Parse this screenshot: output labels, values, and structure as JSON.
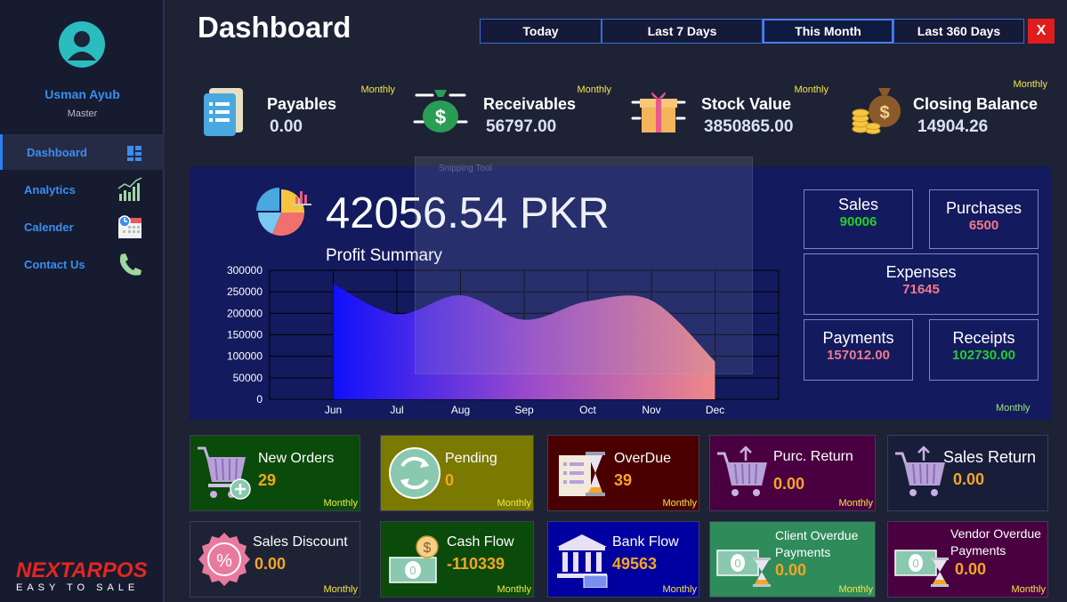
{
  "app": {
    "title": "Dashboard"
  },
  "user": {
    "name": "Usman Ayub",
    "role": "Master"
  },
  "sidebar": {
    "items": [
      {
        "label": "Dashboard",
        "icon": "dashboard-grid-icon"
      },
      {
        "label": "Analytics",
        "icon": "bar-chart-icon"
      },
      {
        "label": "Calender",
        "icon": "calendar-icon"
      },
      {
        "label": "Contact Us",
        "icon": "phone-icon"
      }
    ]
  },
  "logo": {
    "line1": "NEXTARPOS",
    "line2": "EASY TO SALE"
  },
  "ranges": {
    "items": [
      "Today",
      "Last 7 Days",
      "This Month",
      "Last 360 Days"
    ],
    "selected": "This Month",
    "close": "X"
  },
  "kpis": [
    {
      "title": "Payables",
      "value": "0.00",
      "period": "Monthly",
      "color": "#4e4300",
      "icon": "document-list-icon"
    },
    {
      "title": "Receivables",
      "value": "56797.00",
      "period": "Monthly",
      "color": "#008000",
      "icon": "money-bag-icon"
    },
    {
      "title": "Stock Value",
      "value": "3850865.00",
      "period": "Monthly",
      "color": "#7a7a00",
      "icon": "gift-box-icon"
    },
    {
      "title": "Closing Balance",
      "value": "14904.26",
      "period": "Monthly",
      "color": "#2f8c5a",
      "icon": "coins-bag-icon"
    }
  ],
  "profit": {
    "value": "42056.54 PKR",
    "label": "Profit Summary",
    "period": "Monthly"
  },
  "overlay": {
    "text": "Snipping Tool"
  },
  "summary": {
    "sales": {
      "label": "Sales",
      "value": "90006"
    },
    "purchases": {
      "label": "Purchases",
      "value": "6500"
    },
    "expenses": {
      "label": "Expenses",
      "value": "71645"
    },
    "payments": {
      "label": "Payments",
      "value": "157012.00"
    },
    "receipts": {
      "label": "Receipts",
      "value": "102730.00"
    }
  },
  "colors": {
    "green_value": "#22d026",
    "pink_value": "#f07a8a"
  },
  "chart_data": {
    "type": "area",
    "x": [
      "Jun",
      "Jul",
      "Aug",
      "Sep",
      "Oct",
      "Nov",
      "Dec"
    ],
    "values": [
      268000,
      198000,
      242000,
      185000,
      228000,
      230000,
      88000
    ],
    "ylim": [
      0,
      300000
    ],
    "yticks": [
      "0",
      "50000",
      "100000",
      "150000",
      "200000",
      "250000",
      "300000"
    ],
    "grid": true
  },
  "cards": [
    {
      "title": "New Orders",
      "value": "29",
      "period": "Monthly",
      "color": "#0a4a0a",
      "icon": "cart-add-icon"
    },
    {
      "title": "Pending",
      "value": "0",
      "period": "Monthly",
      "color": "#7a7a00",
      "icon": "refresh-cycle-icon"
    },
    {
      "title": "OverDue",
      "value": "39",
      "period": "Monthly",
      "color": "#4a0000",
      "icon": "hourglass-document-icon"
    },
    {
      "title": "Purc. Return",
      "value": "0.00",
      "period": "Monthly",
      "color": "#4a0040",
      "icon": "cart-return-icon"
    },
    {
      "title": "Sales Return",
      "value": "0.00",
      "period": "Monthly",
      "color": "#181d3a",
      "icon": "cart-return-icon"
    },
    {
      "title": "Sales Discount",
      "value": "0.00",
      "period": "Monthly",
      "color": "#1e2235",
      "icon": "discount-badge-icon"
    },
    {
      "title": "Cash Flow",
      "value": "-110339",
      "period": "Monthly",
      "color": "#0a4a0a",
      "icon": "cash-coins-icon"
    },
    {
      "title": "Bank Flow",
      "value": "49563",
      "period": "Monthly",
      "color": "#0000a0",
      "icon": "bank-building-icon"
    },
    {
      "title": "Client Overdue\nPayments",
      "value": "0.00",
      "period": "Monthly",
      "color": "#2f8c5a",
      "icon": "cash-hourglass-icon"
    },
    {
      "title": "Vendor Overdue\nPayments",
      "value": "0.00",
      "period": "Monthly",
      "color": "#4a0040",
      "icon": "cash-hourglass-icon"
    }
  ]
}
